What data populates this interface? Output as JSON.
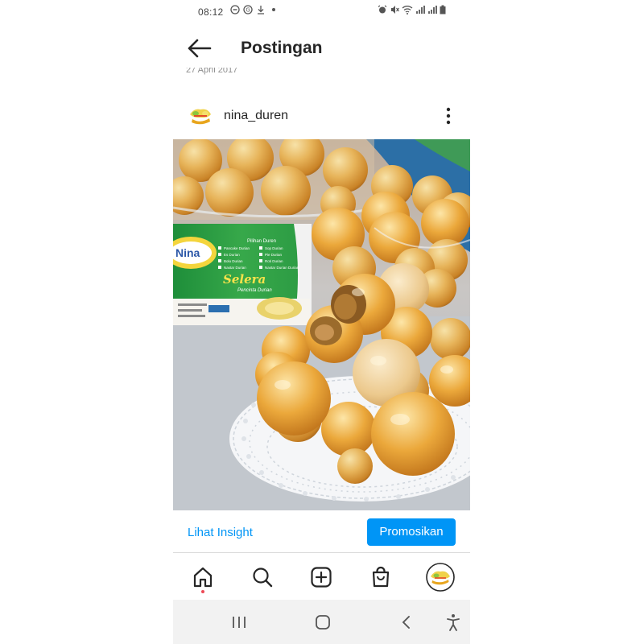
{
  "status_bar": {
    "time": "08:12",
    "left_icons": [
      "dnd-icon",
      "g-icon",
      "download-icon",
      "dot-icon"
    ],
    "right_icons": [
      "alarm-icon",
      "mute-icon",
      "wifi-icon",
      "signal-icon",
      "signal-icon",
      "battery-icon"
    ]
  },
  "header": {
    "title": "Postingan",
    "clipped_date": "27 April 2017"
  },
  "post": {
    "username": "nina_duren"
  },
  "photo_sign": {
    "brand": "Nina",
    "menu_title": "Pilihan Duren",
    "items": [
      "Pancake Durian",
      "Sop Durian",
      "Es Durian",
      "Pie Durian",
      "Bolu Durian",
      "Roti Durian",
      "Nastar Durian",
      "Nastar Durian Durian"
    ],
    "slogan": "Selera",
    "slogan_sub": "Pencinta Durian"
  },
  "actions": {
    "insight": "Lihat Insight",
    "promote": "Promosikan"
  },
  "nav": {
    "items": [
      "home-icon",
      "search-icon",
      "add-post-icon",
      "shop-icon",
      "profile-avatar"
    ]
  },
  "colors": {
    "accent": "#0095f6",
    "notification_dot": "#ed4956",
    "text": "#262626"
  }
}
